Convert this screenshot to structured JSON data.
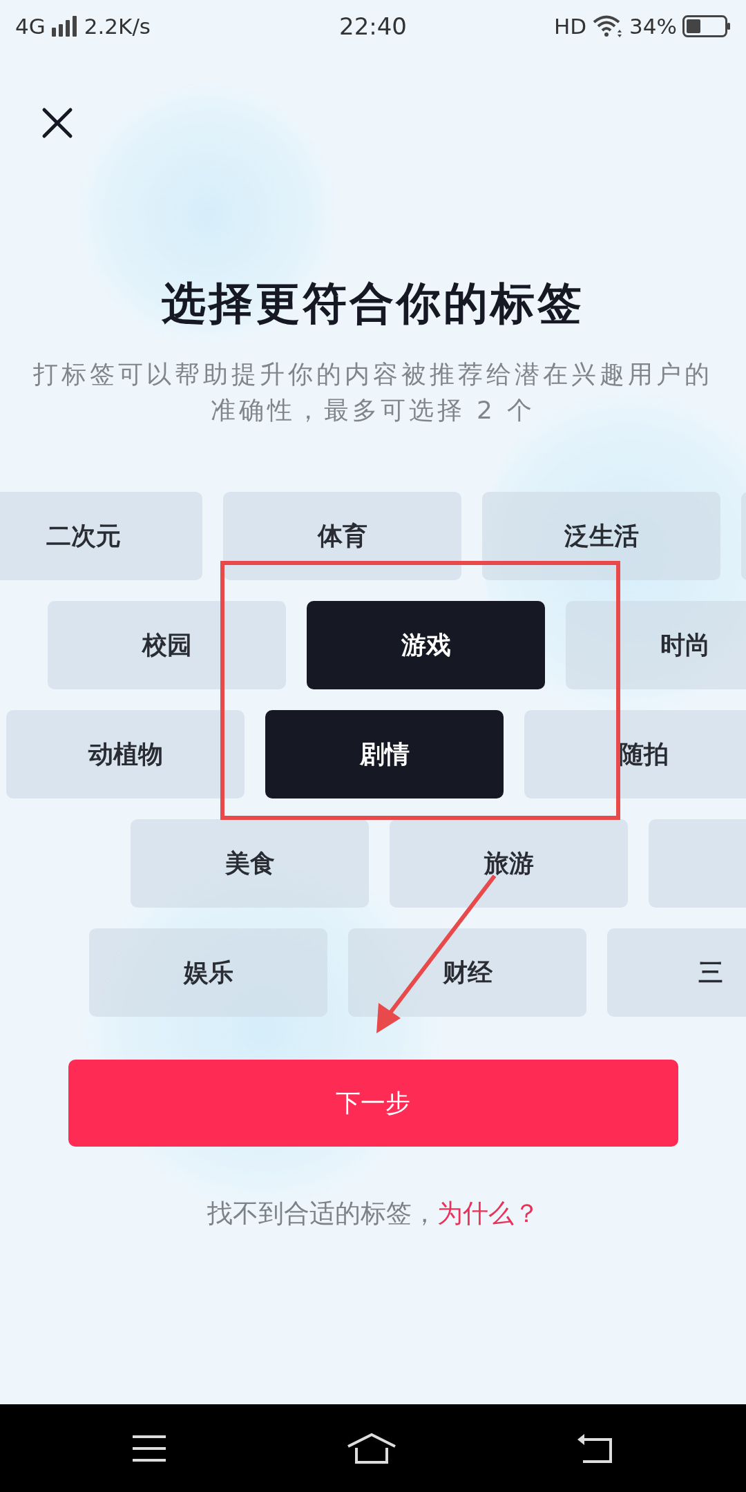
{
  "status_bar": {
    "network": "4G",
    "speed": "2.2K/s",
    "time": "22:40",
    "hd": "HD",
    "battery": "34%"
  },
  "title": "选择更符合你的标签",
  "subtitle": "打标签可以帮助提升你的内容被推荐给潜在兴趣用户的准确性，最多可选择 2 个",
  "tag_rows": [
    [
      {
        "label": "二次元",
        "selected": false
      },
      {
        "label": "体育",
        "selected": false
      },
      {
        "label": "泛生活",
        "selected": false
      },
      {
        "selected": false
      }
    ],
    [
      {
        "label": "校园",
        "selected": false
      },
      {
        "label": "游戏",
        "selected": true
      },
      {
        "label": "时尚",
        "selected": false
      }
    ],
    [
      {
        "label": "动植物",
        "selected": false
      },
      {
        "label": "剧情",
        "selected": true
      },
      {
        "label": "随拍",
        "selected": false
      }
    ],
    [
      {
        "label": "美食",
        "selected": false
      },
      {
        "label": "旅游",
        "selected": false
      },
      {
        "selected": false
      }
    ],
    [
      {
        "label": "娱乐",
        "selected": false
      },
      {
        "label": "财经",
        "selected": false
      },
      {
        "label": "三",
        "selected": false,
        "kind": "clipped"
      }
    ]
  ],
  "next_button": "下一步",
  "footer": {
    "text": "找不到合适的标签，",
    "link": "为什么？"
  }
}
